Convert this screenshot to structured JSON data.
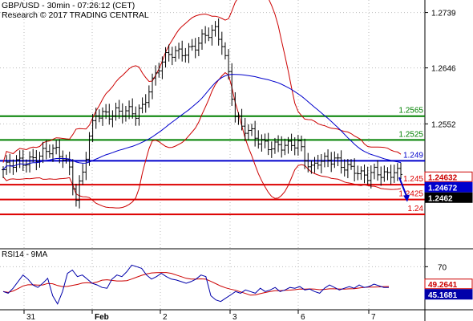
{
  "header": {
    "title": "GBP/USD - 30min - 07:26:12 (CET)",
    "research": "Research © 2017 TRADING CENTRAL"
  },
  "colors": {
    "candle": "#000000",
    "bollinger": "#cc0000",
    "moving_average": "#0000cc",
    "resistance": "#008000",
    "pivot": "#0000cc",
    "support": "#dd0000",
    "last_price_box": "#000000",
    "rsi_line": "#0000aa",
    "rsi_signal": "#cc0000",
    "grid": "#bbbbbb"
  },
  "chart_data": {
    "type": "candlestick",
    "title": "GBP/USD - 30min - 07:26:12 (CET)",
    "price_axis": {
      "ticks": [
        1.2739,
        1.2646,
        1.2552
      ],
      "labels": [
        "1.2739",
        "1.2646",
        "1.2552"
      ],
      "range": [
        1.2345,
        1.276
      ]
    },
    "x_axis": {
      "labels": [
        "31",
        "Feb",
        "2",
        "3",
        "6",
        "7"
      ]
    },
    "levels": [
      {
        "label": "1.2565",
        "value": 1.2565,
        "kind": "resistance",
        "color": "#008000"
      },
      {
        "label": "1.2525",
        "value": 1.2525,
        "kind": "resistance",
        "color": "#008000"
      },
      {
        "label": "1.249",
        "value": 1.249,
        "kind": "pivot",
        "color": "#0000cc"
      },
      {
        "label": "1.245",
        "value": 1.245,
        "kind": "support",
        "color": "#dd0000"
      },
      {
        "label": "1.2425",
        "value": 1.2425,
        "kind": "support",
        "color": "#dd0000"
      },
      {
        "label": "1.24",
        "value": 1.24,
        "kind": "support",
        "color": "#dd0000"
      }
    ],
    "price_markers": [
      {
        "label": "1.24632",
        "value": 1.24632,
        "bg": "#ffffff",
        "fg": "#cc0000"
      },
      {
        "label": "1.24672",
        "value": 1.24672,
        "bg": "#0000cc",
        "fg": "#ffffff"
      },
      {
        "label": "1.2462",
        "value": 1.2462,
        "bg": "#000000",
        "fg": "#ffffff"
      }
    ],
    "close_path": [
      [
        0,
        1.2475
      ],
      [
        6,
        1.2488
      ],
      [
        10,
        1.25
      ],
      [
        14,
        1.2505
      ],
      [
        18,
        1.2498
      ],
      [
        20,
        1.248
      ],
      [
        22,
        1.243
      ],
      [
        24,
        1.247
      ],
      [
        26,
        1.2525
      ],
      [
        28,
        1.2565
      ],
      [
        31,
        1.257
      ],
      [
        34,
        1.2575
      ],
      [
        37,
        1.257
      ],
      [
        40,
        1.2565
      ],
      [
        42,
        1.258
      ],
      [
        44,
        1.2615
      ],
      [
        47,
        1.265
      ],
      [
        50,
        1.2665
      ],
      [
        53,
        1.267
      ],
      [
        56,
        1.268
      ],
      [
        59,
        1.269
      ],
      [
        62,
        1.27
      ],
      [
        64,
        1.2705
      ],
      [
        66,
        1.269
      ],
      [
        68,
        1.264
      ],
      [
        70,
        1.257
      ],
      [
        72,
        1.2545
      ],
      [
        74,
        1.2535
      ],
      [
        77,
        1.2525
      ],
      [
        80,
        1.252
      ],
      [
        83,
        1.2515
      ],
      [
        86,
        1.251
      ],
      [
        89,
        1.252
      ],
      [
        91,
        1.25
      ],
      [
        93,
        1.248
      ],
      [
        95,
        1.249
      ],
      [
        97,
        1.2485
      ],
      [
        100,
        1.249
      ],
      [
        103,
        1.2485
      ],
      [
        106,
        1.2478
      ],
      [
        108,
        1.2462
      ],
      [
        110,
        1.246
      ],
      [
        112,
        1.247
      ],
      [
        114,
        1.2472
      ],
      [
        116,
        1.247
      ],
      [
        118,
        1.2475
      ],
      [
        120,
        1.2462
      ]
    ],
    "projection_arrow": {
      "from": 1.2462,
      "to": 1.2425
    }
  },
  "rsi": {
    "title": "RSI14 - 9MA",
    "ticks": [
      "70"
    ],
    "range": [
      20,
      80
    ],
    "markers": [
      {
        "label": "49.2641",
        "value": 49.2641,
        "bg": "#ffffff",
        "fg": "#cc0000"
      },
      {
        "label": "45.1681",
        "value": 45.1681,
        "bg": "#0000aa",
        "fg": "#ffffff"
      }
    ],
    "values": [
      40,
      38,
      44,
      52,
      60,
      55,
      48,
      45,
      50,
      56,
      35,
      25,
      40,
      62,
      66,
      58,
      60,
      55,
      50,
      48,
      45,
      44,
      55,
      60,
      58,
      64,
      72,
      70,
      68,
      60,
      55,
      58,
      62,
      58,
      55,
      54,
      52,
      50,
      52,
      55,
      60,
      58,
      35,
      30,
      28,
      32,
      36,
      40,
      38,
      42,
      40,
      38,
      44,
      40,
      42,
      45,
      40,
      42,
      45,
      44,
      46,
      42,
      43,
      40,
      38,
      44,
      48,
      45,
      42,
      44,
      46,
      44,
      48,
      45,
      46,
      49,
      47,
      45,
      45
    ]
  }
}
